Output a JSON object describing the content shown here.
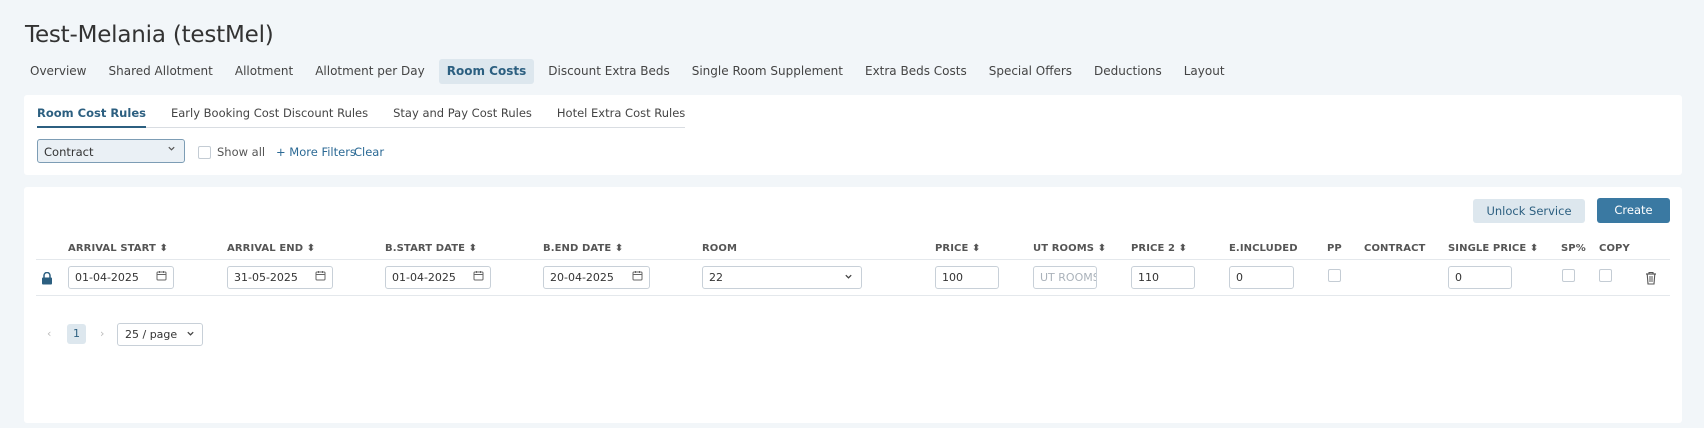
{
  "header": {
    "title": "Test-Melania (testMel)"
  },
  "tabs": [
    {
      "label": "Overview"
    },
    {
      "label": "Shared Allotment"
    },
    {
      "label": "Allotment"
    },
    {
      "label": "Allotment per Day"
    },
    {
      "label": "Room Costs"
    },
    {
      "label": "Discount Extra Beds"
    },
    {
      "label": "Single Room Supplement"
    },
    {
      "label": "Extra Beds Costs"
    },
    {
      "label": "Special Offers"
    },
    {
      "label": "Deductions"
    },
    {
      "label": "Layout"
    }
  ],
  "active_tab": "Room Costs",
  "subtabs": [
    {
      "label": "Room Cost Rules"
    },
    {
      "label": "Early Booking Cost Discount Rules"
    },
    {
      "label": "Stay and Pay Cost Rules"
    },
    {
      "label": "Hotel Extra Cost Rules"
    }
  ],
  "filters": {
    "contract_select": "Contract",
    "show_all_label": "Show all",
    "more_filters": "+ More Filters",
    "clear": "Clear"
  },
  "actions": {
    "unlock": "Unlock Service",
    "create": "Create"
  },
  "table": {
    "headers": {
      "arrival_start": "ARRIVAL START",
      "arrival_end": "ARRIVAL END",
      "bstart": "B.START DATE",
      "bend": "B.END DATE",
      "room": "ROOM",
      "price": "PRICE",
      "ut_rooms": "UT ROOMS",
      "price2": "PRICE 2",
      "eincluded": "E.INCLUDED",
      "pp": "PP",
      "contract": "CONTRACT",
      "single_price": "SINGLE PRICE",
      "sp": "SP%",
      "copy": "COPY"
    },
    "row": {
      "arrival_start": "01-04-2025",
      "arrival_end": "31-05-2025",
      "bstart": "01-04-2025",
      "bend": "20-04-2025",
      "room": "22",
      "price": "100",
      "ut_rooms_placeholder": "UT ROOMS",
      "price2": "110",
      "eincluded": "0",
      "single_price": "0"
    }
  },
  "pagination": {
    "page": "1",
    "per_page": "25 / page"
  },
  "colors": {
    "accent": "#3a79a2",
    "active_text": "#2c5f80",
    "active_bg": "#dde7ee",
    "background": "#f2f6f9"
  }
}
